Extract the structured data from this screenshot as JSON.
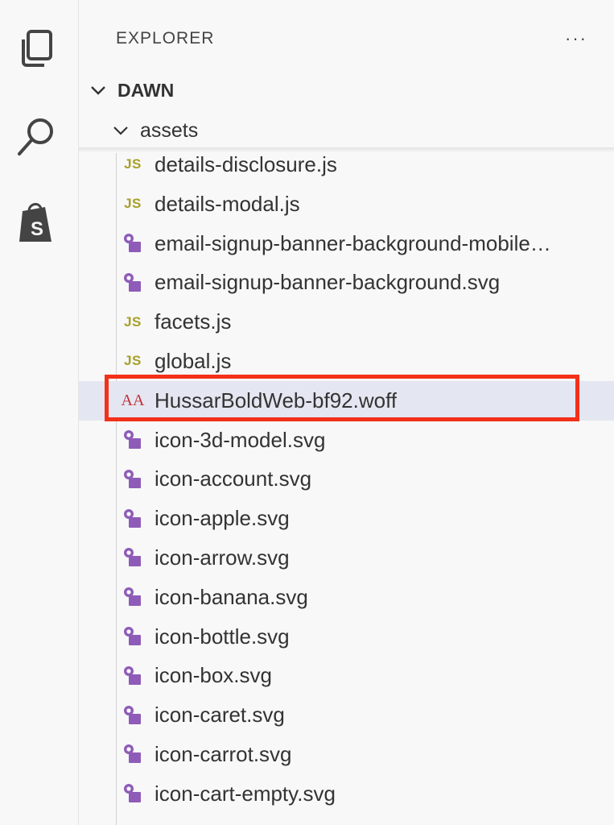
{
  "sidebar": {
    "title": "EXPLORER",
    "more_label": "···",
    "workspace": "DAWN",
    "folder": "assets"
  },
  "activity_bar": {
    "icons": [
      "files-icon",
      "search-icon",
      "shopify-icon"
    ]
  },
  "files": [
    {
      "name": "details-disclosure.js",
      "type": "js",
      "icon_label": "JS"
    },
    {
      "name": "details-modal.js",
      "type": "js",
      "icon_label": "JS"
    },
    {
      "name": "email-signup-banner-background-mobile…",
      "type": "svg",
      "icon_label": ""
    },
    {
      "name": "email-signup-banner-background.svg",
      "type": "svg",
      "icon_label": ""
    },
    {
      "name": "facets.js",
      "type": "js",
      "icon_label": "JS"
    },
    {
      "name": "global.js",
      "type": "js",
      "icon_label": "JS"
    },
    {
      "name": "HussarBoldWeb-bf92.woff",
      "type": "font",
      "icon_label": "AA",
      "selected": true
    },
    {
      "name": "icon-3d-model.svg",
      "type": "svg",
      "icon_label": ""
    },
    {
      "name": "icon-account.svg",
      "type": "svg",
      "icon_label": ""
    },
    {
      "name": "icon-apple.svg",
      "type": "svg",
      "icon_label": ""
    },
    {
      "name": "icon-arrow.svg",
      "type": "svg",
      "icon_label": ""
    },
    {
      "name": "icon-banana.svg",
      "type": "svg",
      "icon_label": ""
    },
    {
      "name": "icon-bottle.svg",
      "type": "svg",
      "icon_label": ""
    },
    {
      "name": "icon-box.svg",
      "type": "svg",
      "icon_label": ""
    },
    {
      "name": "icon-caret.svg",
      "type": "svg",
      "icon_label": ""
    },
    {
      "name": "icon-carrot.svg",
      "type": "svg",
      "icon_label": ""
    },
    {
      "name": "icon-cart-empty.svg",
      "type": "svg",
      "icon_label": ""
    }
  ],
  "colors": {
    "js_icon": "#a8a02a",
    "svg_icon": "#8e5cb8",
    "font_icon": "#c0323a",
    "highlight": "#f3301a",
    "selected_row": "#e4e6f1"
  }
}
